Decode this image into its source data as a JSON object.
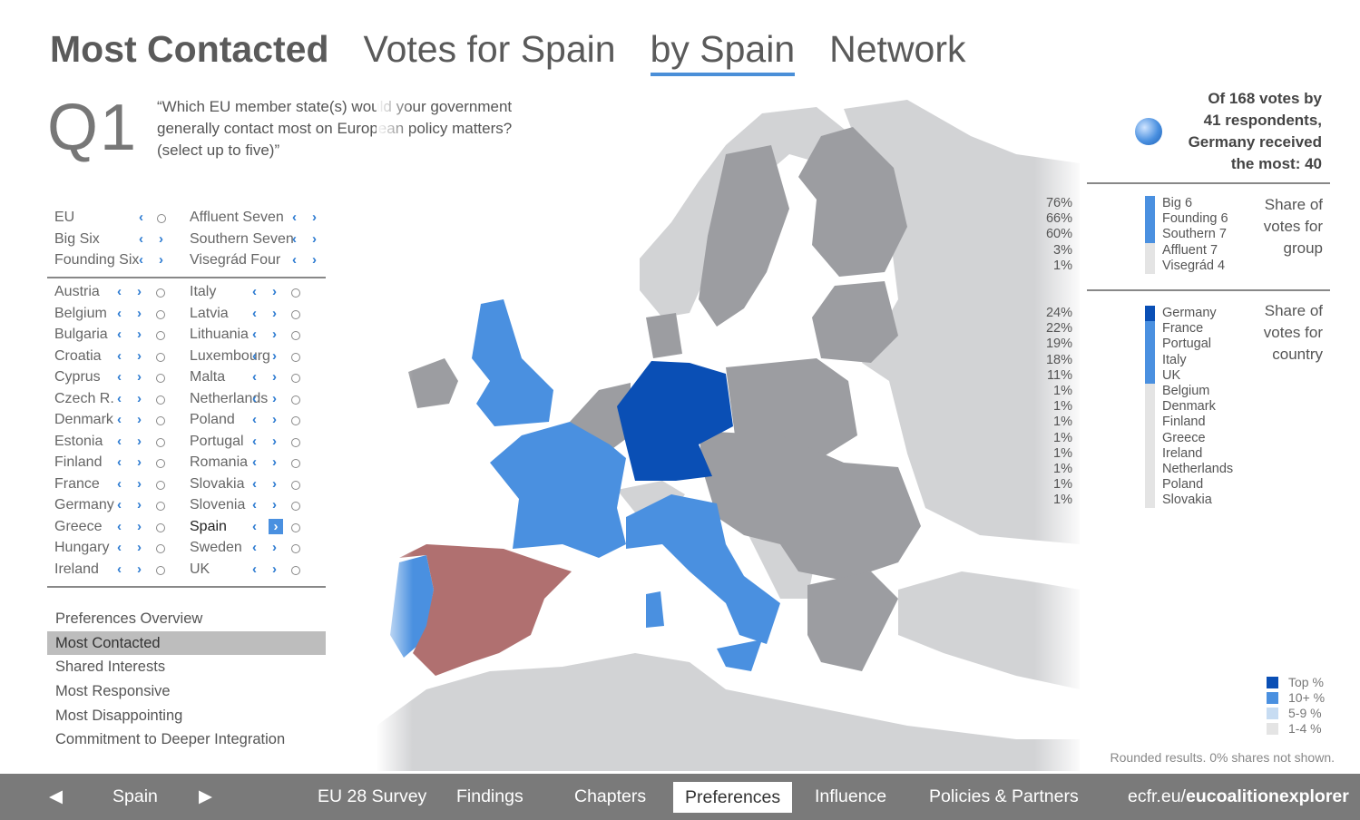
{
  "tabs": [
    {
      "label": "Most Contacted"
    },
    {
      "label": "Votes for Spain"
    },
    {
      "label": "by Spain"
    },
    {
      "label": "Network"
    }
  ],
  "question": {
    "number": "Q1",
    "text": "“Which EU member state(s) would your government generally contact most on European policy matters? (select up to five)”"
  },
  "groups": {
    "left": [
      "EU",
      "Big Six",
      "Founding Six"
    ],
    "right": [
      "Affluent Seven",
      "Southern Seven",
      "Visegrád Four"
    ]
  },
  "countries": {
    "left": [
      "Austria",
      "Belgium",
      "Bulgaria",
      "Croatia",
      "Cyprus",
      "Czech R.",
      "Denmark",
      "Estonia",
      "Finland",
      "France",
      "Germany",
      "Greece",
      "Hungary",
      "Ireland"
    ],
    "right": [
      "Italy",
      "Latvia",
      "Lithuania",
      "Luxembourg",
      "Malta",
      "Netherlands",
      "Poland",
      "Portugal",
      "Romania",
      "Slovakia",
      "Slovenia",
      "Spain",
      "Sweden",
      "UK"
    ],
    "selected": "Spain"
  },
  "icons": {
    "prev": "‹",
    "next": "›"
  },
  "nav": [
    "Preferences Overview",
    "Most Contacted",
    "Shared Interests",
    "Most Responsive",
    "Most Disappointing",
    "Commitment to Deeper Integration"
  ],
  "nav_active": "Most Contacted",
  "summary": {
    "line1": "Of 168 votes by",
    "line2": "41 respondents,",
    "line3": "Germany received",
    "line4": "the most: 40"
  },
  "group_share": {
    "title": [
      "Share of",
      "votes for",
      "group"
    ],
    "rows": [
      {
        "pct": "76%",
        "label": "Big 6",
        "color": "#4a90e0"
      },
      {
        "pct": "66%",
        "label": "Founding 6",
        "color": "#4a90e0"
      },
      {
        "pct": "60%",
        "label": "Southern 7",
        "color": "#4a90e0"
      },
      {
        "pct": "3%",
        "label": "Affluent 7",
        "color": "#e4e4e4"
      },
      {
        "pct": "1%",
        "label": "Visegrád 4",
        "color": "#e4e4e4"
      }
    ]
  },
  "country_share": {
    "title": [
      "Share of",
      "votes for",
      "country"
    ],
    "rows": [
      {
        "pct": "24%",
        "label": "Germany",
        "color": "#0a4fb5"
      },
      {
        "pct": "22%",
        "label": "France",
        "color": "#4a90e0"
      },
      {
        "pct": "19%",
        "label": "Portugal",
        "color": "#4a90e0"
      },
      {
        "pct": "18%",
        "label": "Italy",
        "color": "#4a90e0"
      },
      {
        "pct": "11%",
        "label": "UK",
        "color": "#4a90e0"
      },
      {
        "pct": "1%",
        "label": "Belgium",
        "color": "#e4e4e4"
      },
      {
        "pct": "1%",
        "label": "Denmark",
        "color": "#e4e4e4"
      },
      {
        "pct": "1%",
        "label": "Finland",
        "color": "#e4e4e4"
      },
      {
        "pct": "1%",
        "label": "Greece",
        "color": "#e4e4e4"
      },
      {
        "pct": "1%",
        "label": "Ireland",
        "color": "#e4e4e4"
      },
      {
        "pct": "1%",
        "label": "Netherlands",
        "color": "#e4e4e4"
      },
      {
        "pct": "1%",
        "label": "Poland",
        "color": "#e4e4e4"
      },
      {
        "pct": "1%",
        "label": "Slovakia",
        "color": "#e4e4e4"
      }
    ]
  },
  "legend": [
    {
      "label": "Top  %",
      "color": "#0a4fb5"
    },
    {
      "label": "10+  %",
      "color": "#4a90e0"
    },
    {
      "label": "5-9  %",
      "color": "#c7dcf2"
    },
    {
      "label": "1-4  %",
      "color": "#e4e4e4"
    }
  ],
  "note": "Rounded results. 0% shares not shown.",
  "map_colors": {
    "germany": "#0a4fb5",
    "blue": "#4a90e0",
    "spain": "#b07070",
    "member": "#9c9da1",
    "nonmember": "#d2d3d5"
  },
  "bottom": {
    "prev_icon": "◀",
    "country": "Spain",
    "next_icon": "▶",
    "items": [
      "EU 28 Survey",
      "Findings",
      "Chapters",
      "Preferences",
      "Influence",
      "Policies & Partners"
    ],
    "active": "Preferences",
    "site_prefix": "ecfr.eu/",
    "site_bold": "eucoalitionexplorer"
  }
}
